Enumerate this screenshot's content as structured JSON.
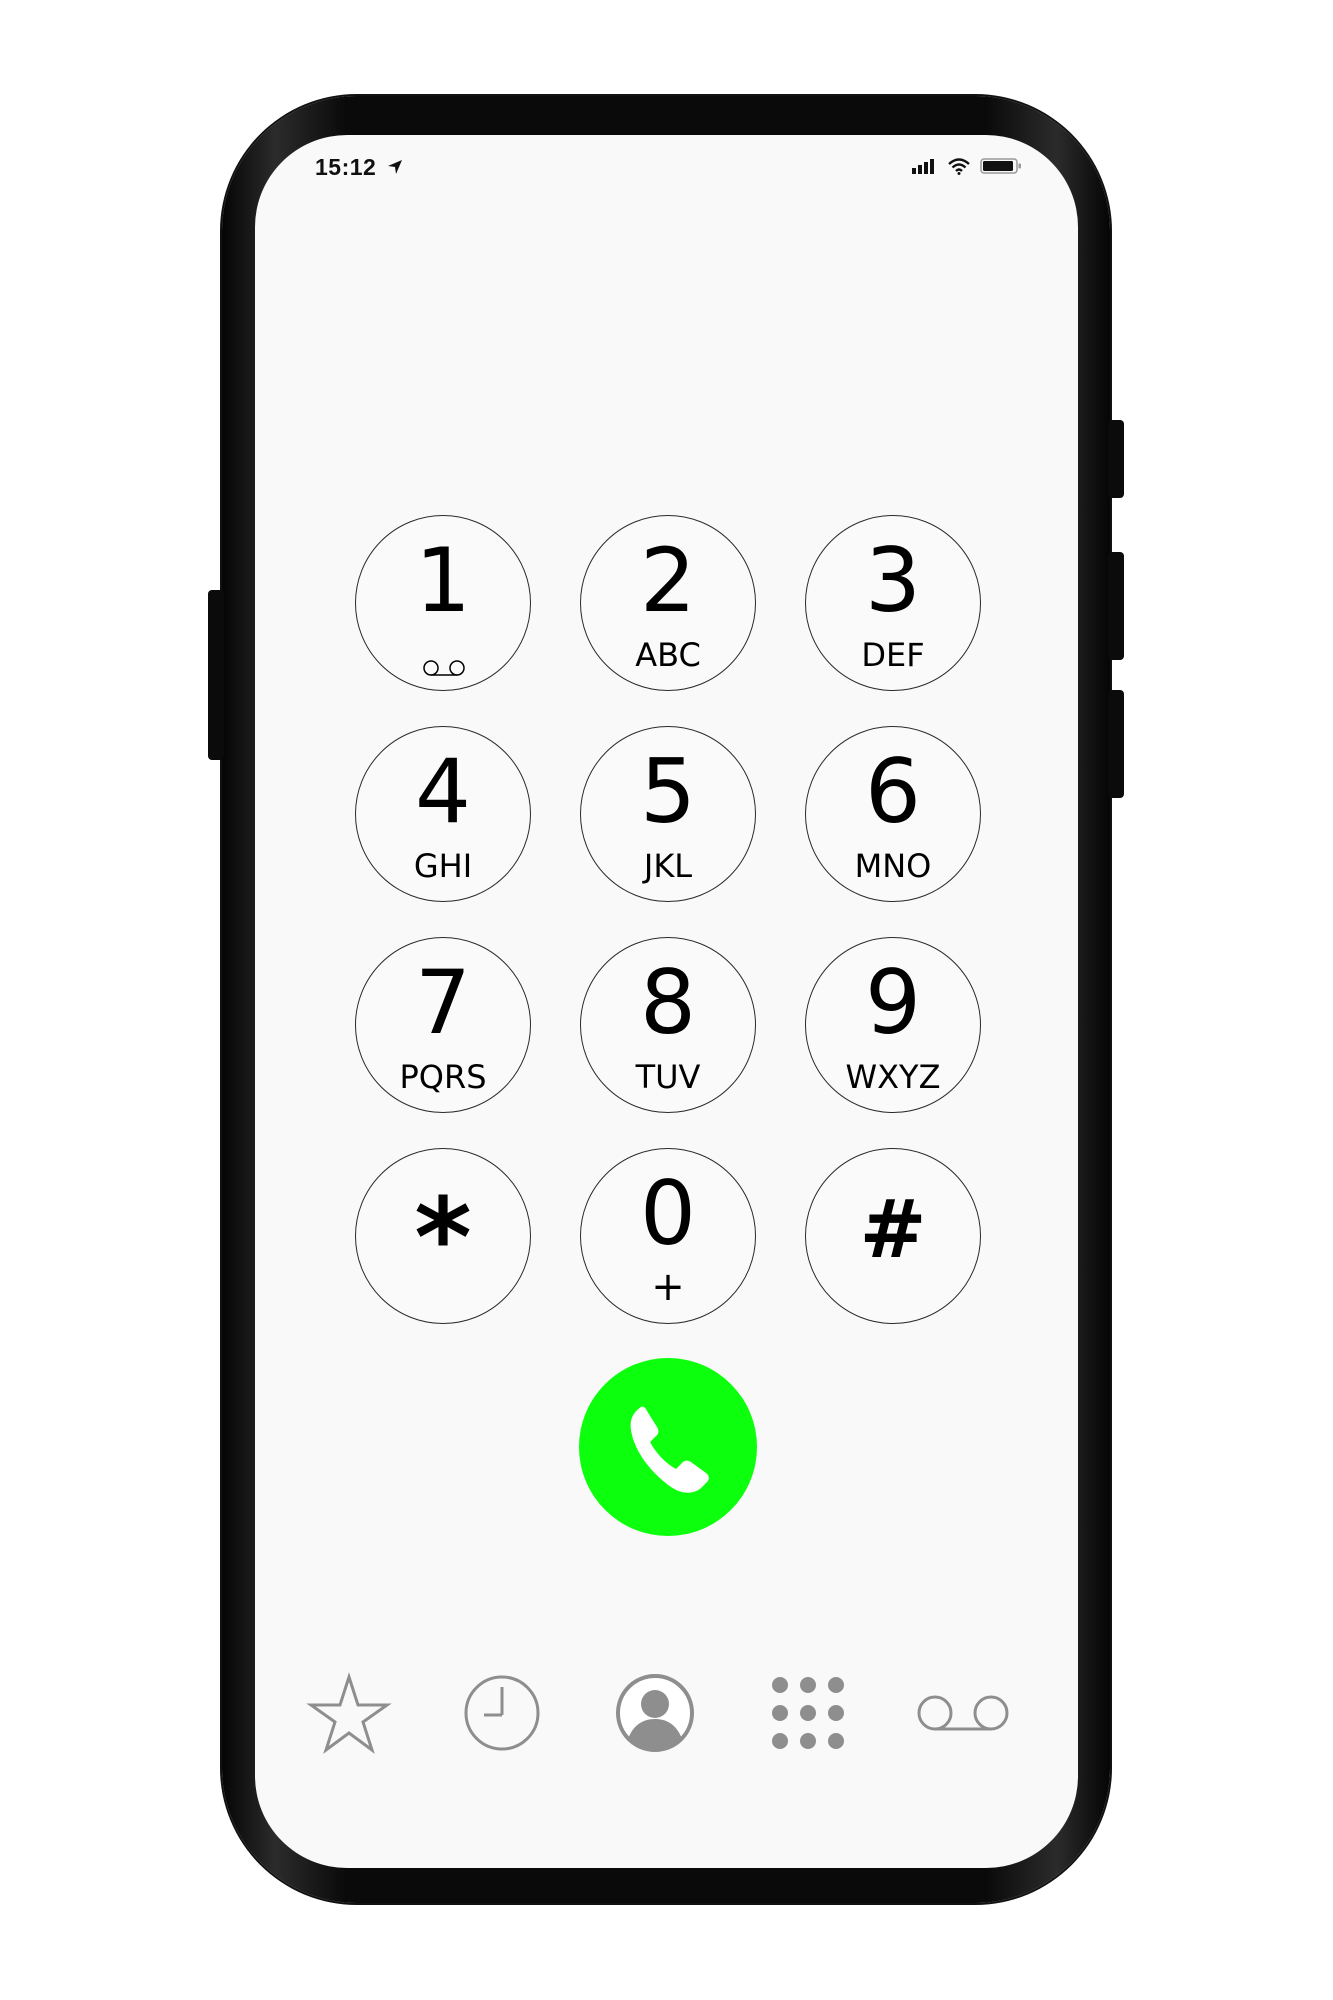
{
  "status_bar": {
    "time": "15:12",
    "location_icon": "location-arrow-icon",
    "signal_icon": "cellular-signal-icon",
    "wifi_icon": "wifi-icon",
    "battery_icon": "battery-icon"
  },
  "keypad": {
    "keys": [
      {
        "digit": "1",
        "letters": "",
        "icon": "voicemail-icon"
      },
      {
        "digit": "2",
        "letters": "ABC"
      },
      {
        "digit": "3",
        "letters": "DEF"
      },
      {
        "digit": "4",
        "letters": "GHI"
      },
      {
        "digit": "5",
        "letters": "JKL"
      },
      {
        "digit": "6",
        "letters": "MNO"
      },
      {
        "digit": "7",
        "letters": "PQRS"
      },
      {
        "digit": "8",
        "letters": "TUV"
      },
      {
        "digit": "9",
        "letters": "WXYZ"
      },
      {
        "digit": "*",
        "letters": ""
      },
      {
        "digit": "0",
        "letters": "+"
      },
      {
        "digit": "#",
        "letters": ""
      }
    ]
  },
  "call_button": {
    "icon": "phone-handset-icon",
    "color": "#0cff0c"
  },
  "tab_bar": {
    "items": [
      {
        "name": "favorites",
        "icon": "star-icon"
      },
      {
        "name": "recents",
        "icon": "clock-icon"
      },
      {
        "name": "contacts",
        "icon": "person-icon"
      },
      {
        "name": "keypad",
        "icon": "keypad-icon"
      },
      {
        "name": "voicemail",
        "icon": "voicemail-icon"
      }
    ],
    "icon_color": "#8e8e8e"
  }
}
